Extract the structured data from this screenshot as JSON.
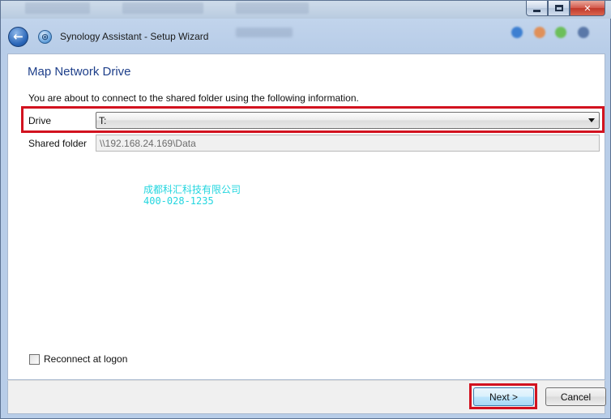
{
  "window": {
    "title": "Synology Assistant - Setup Wizard"
  },
  "page": {
    "heading": "Map Network Drive",
    "intro": "You are about to connect to the shared folder using the following information.",
    "drive": {
      "label": "Drive",
      "selected": "T:"
    },
    "shared_folder": {
      "label": "Shared folder",
      "value": "\\\\192.168.24.169\\Data"
    },
    "watermark": {
      "line1": "成都科汇科技有限公司",
      "line2": "400-028-1235"
    },
    "reconnect": {
      "label": "Reconnect at logon",
      "checked": false
    }
  },
  "footer": {
    "next_label": "Next >",
    "cancel_label": "Cancel"
  },
  "colors": {
    "highlight_border": "#d2121f",
    "heading": "#1e3f8a",
    "watermark": "#23d6df"
  }
}
